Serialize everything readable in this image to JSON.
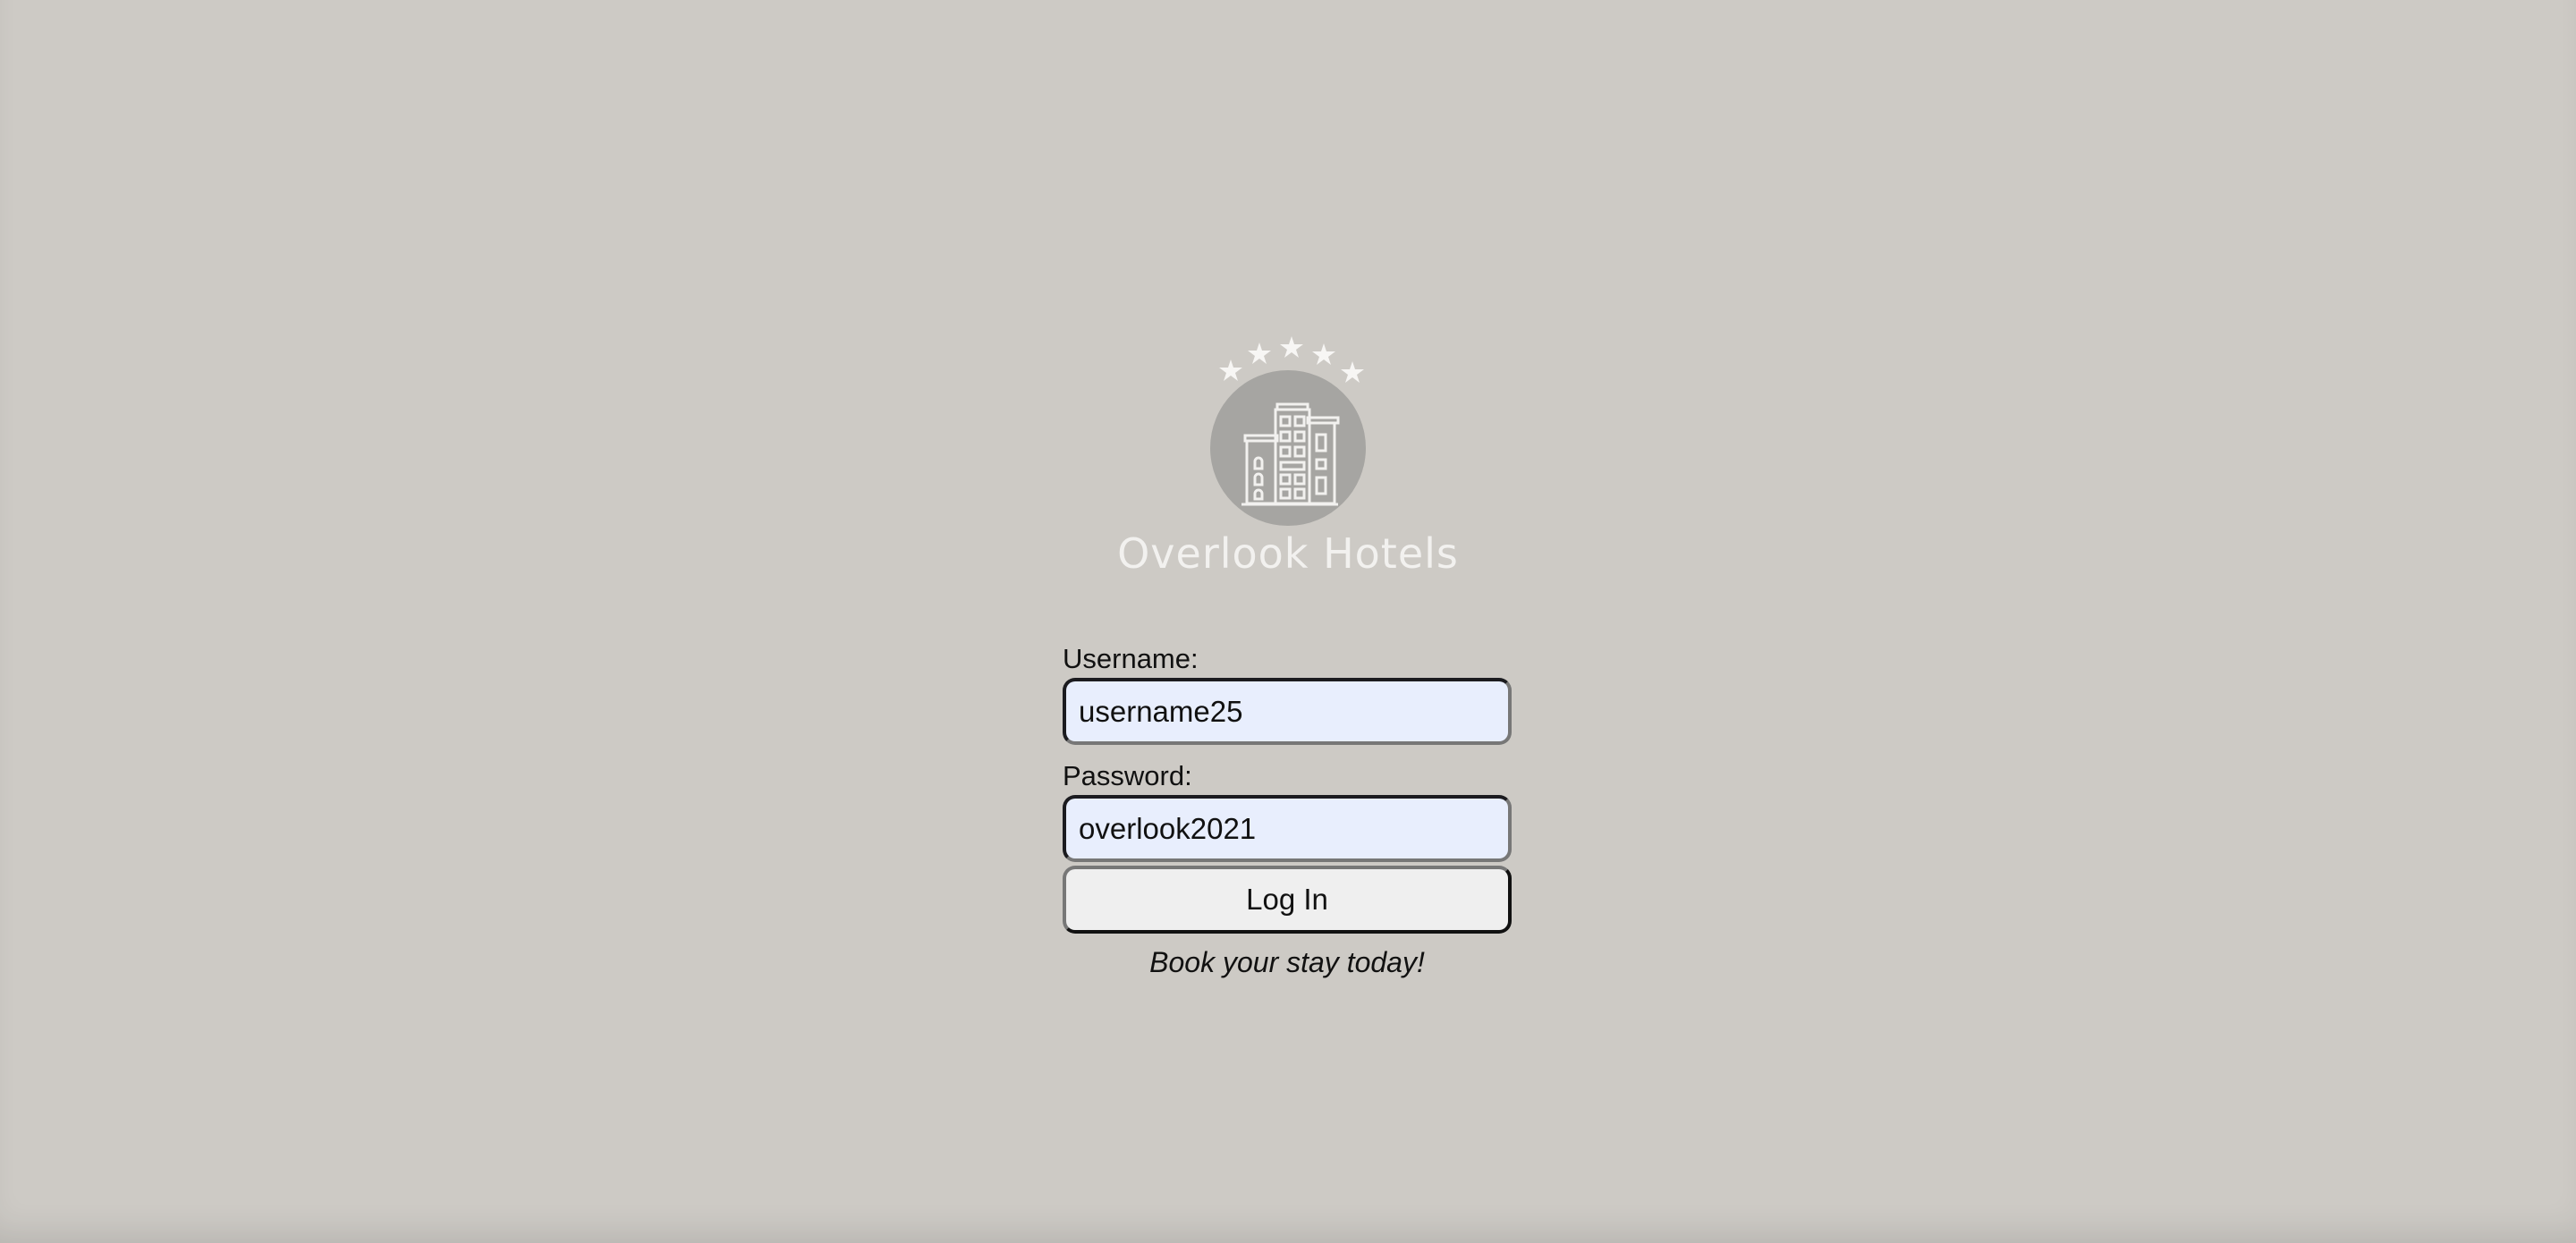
{
  "brand": {
    "name": "Overlook Hotels",
    "logo_icon": "hotel-building-icon",
    "star_icon": "star-icon"
  },
  "login_form": {
    "username_label": "Username:",
    "username_value": "username25",
    "password_label": "Password:",
    "password_value": "overlook2021",
    "submit_label": "Log In",
    "tagline": "Book your stay today!"
  },
  "colors": {
    "background": "#cdcac5",
    "logo_circle": "#a6a5a2",
    "logo_lines": "#f2f1ef",
    "input_background": "#e8eefd",
    "button_background": "#efefef"
  }
}
